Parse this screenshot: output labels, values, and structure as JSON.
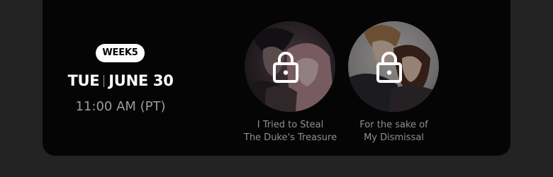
{
  "schedule": {
    "week_badge": "WEEK5",
    "day": "TUE",
    "date": "JUNE 30",
    "time": "11:00 AM (PT)"
  },
  "titles": [
    {
      "line1": "I Tried to Steal",
      "line2": "The Duke's Treasure",
      "locked": true,
      "icon": "lock-icon"
    },
    {
      "line1": "For the sake of",
      "line2": "My Dismissal",
      "locked": true,
      "icon": "lock-icon"
    }
  ],
  "colors": {
    "page_background": "#232323",
    "card_background": "#050505",
    "badge_background": "#ffffff",
    "primary_text": "#ffffff",
    "secondary_text": "#9b9b9b",
    "title_text": "#8f8f8f"
  }
}
